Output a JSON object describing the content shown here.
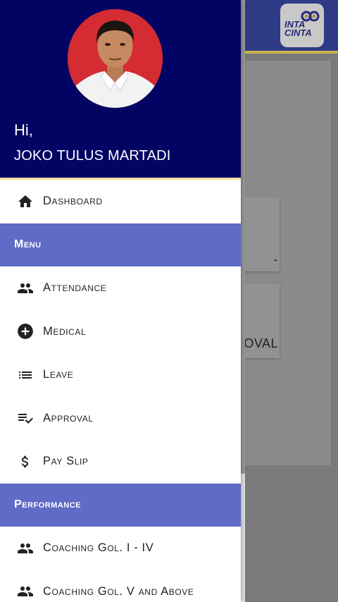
{
  "background": {
    "logo_text": "INTA CINTA",
    "card1_text": "-",
    "card2_text": "OVAL"
  },
  "drawer": {
    "greeting": "Hi,",
    "user_name": "JOKO TULUS MARTADI",
    "dashboard": {
      "label": "Dashboard",
      "icon": "home-icon"
    },
    "sections": [
      {
        "title": "Menu",
        "items": [
          {
            "label": "Attendance",
            "icon": "people-icon"
          },
          {
            "label": "Medical",
            "icon": "plus-circle-icon"
          },
          {
            "label": "Leave",
            "icon": "list-icon"
          },
          {
            "label": "Approval",
            "icon": "checklist-icon"
          },
          {
            "label": "Pay Slip",
            "icon": "dollar-icon"
          }
        ]
      },
      {
        "title": "Performance",
        "items": [
          {
            "label": "Coaching Gol. I - IV",
            "icon": "people-icon"
          },
          {
            "label": "Coaching Gol. V and Above",
            "icon": "people-icon"
          }
        ]
      }
    ]
  },
  "colors": {
    "header_bg": "#020463",
    "section_bg": "#5f6bc6",
    "accent_line": "#efe39a"
  }
}
